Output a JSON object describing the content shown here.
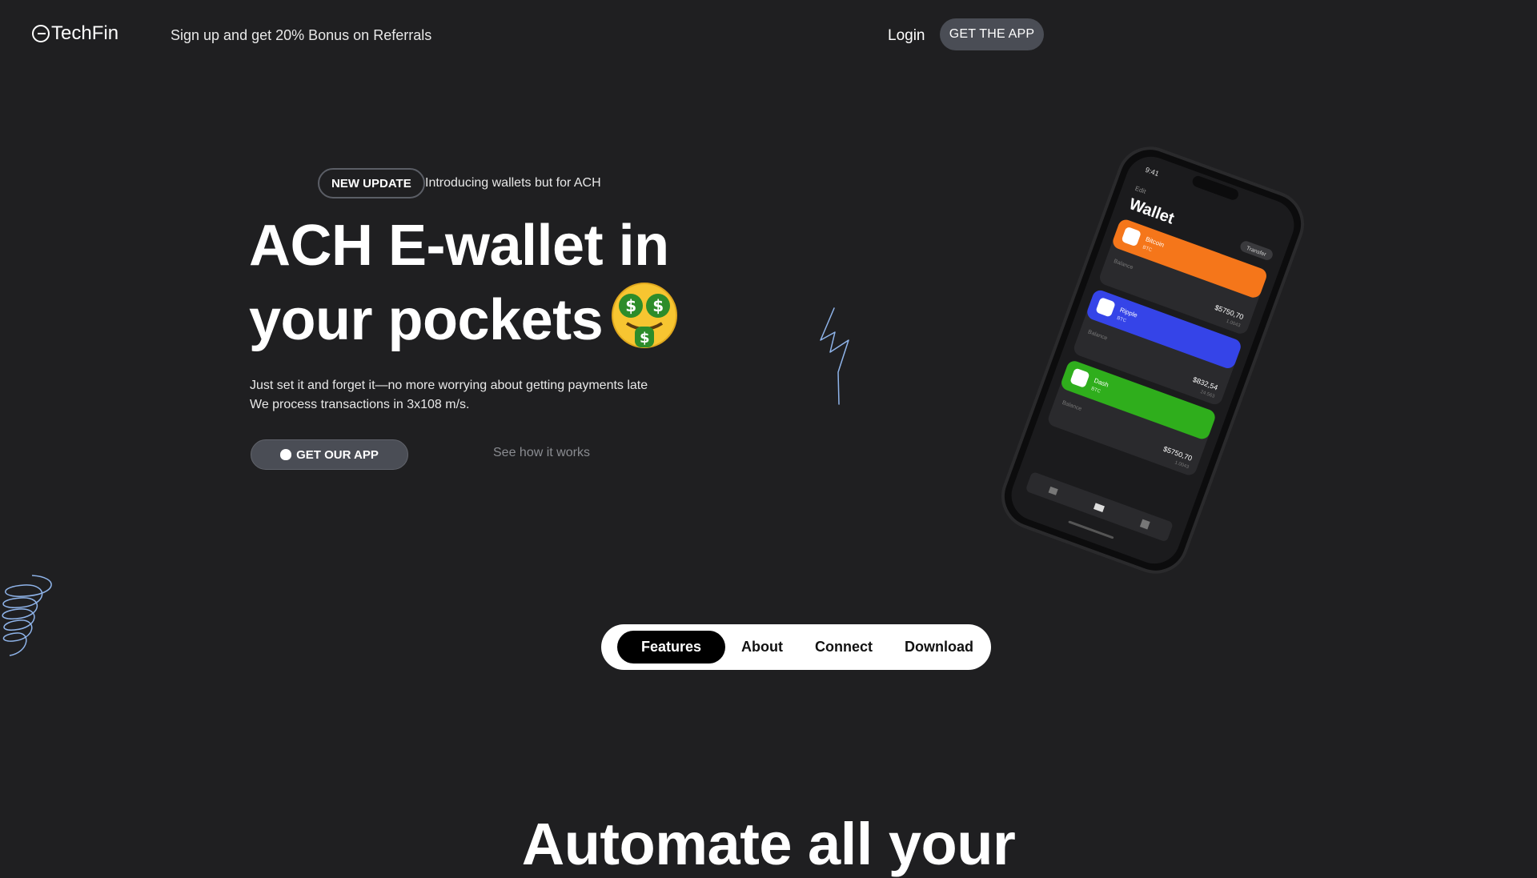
{
  "header": {
    "brand": "TechFin",
    "promo": "Sign up and get 20% Bonus on Referrals",
    "login_label": "Login",
    "get_app_label": "GET THE APP"
  },
  "hero": {
    "badge": "NEW UPDATE",
    "badge_text": "Introducing wallets but for ACH",
    "headline_line1": "ACH E-wallet in",
    "headline_line2": "your pockets",
    "emoji": "money-mouth-face",
    "subtitle_line1": "Just set it and forget it—no more worrying about getting payments late",
    "subtitle_line2": "We process transactions in 3x108 m/s.",
    "cta_label": "GET OUR APP",
    "secondary_label": "See how it works"
  },
  "phone": {
    "time": "9:41",
    "edit": "Edit",
    "title": "Wallet",
    "transfer": "Transfer",
    "cards": [
      {
        "name": "Bitcoin",
        "ticker": "BTC",
        "color": "#f5761a",
        "balance_label": "Balance",
        "amount": "$5750,70",
        "sub": "1.0043"
      },
      {
        "name": "Ripple",
        "ticker": "BTC",
        "color": "#3544e8",
        "balance_label": "Balance",
        "amount": "$832,54",
        "sub": "24.563"
      },
      {
        "name": "Dash",
        "ticker": "BTC",
        "color": "#2fae1c",
        "balance_label": "Balance",
        "amount": "$5750,70",
        "sub": "1.0043"
      }
    ]
  },
  "nav": {
    "items": [
      "Features",
      "About",
      "Connect",
      "Download"
    ],
    "active": "Features"
  },
  "section": {
    "title": "Automate all your"
  },
  "colors": {
    "background": "#1f1f21",
    "button": "#4a4d55",
    "doodle": "#8fb4ea"
  }
}
